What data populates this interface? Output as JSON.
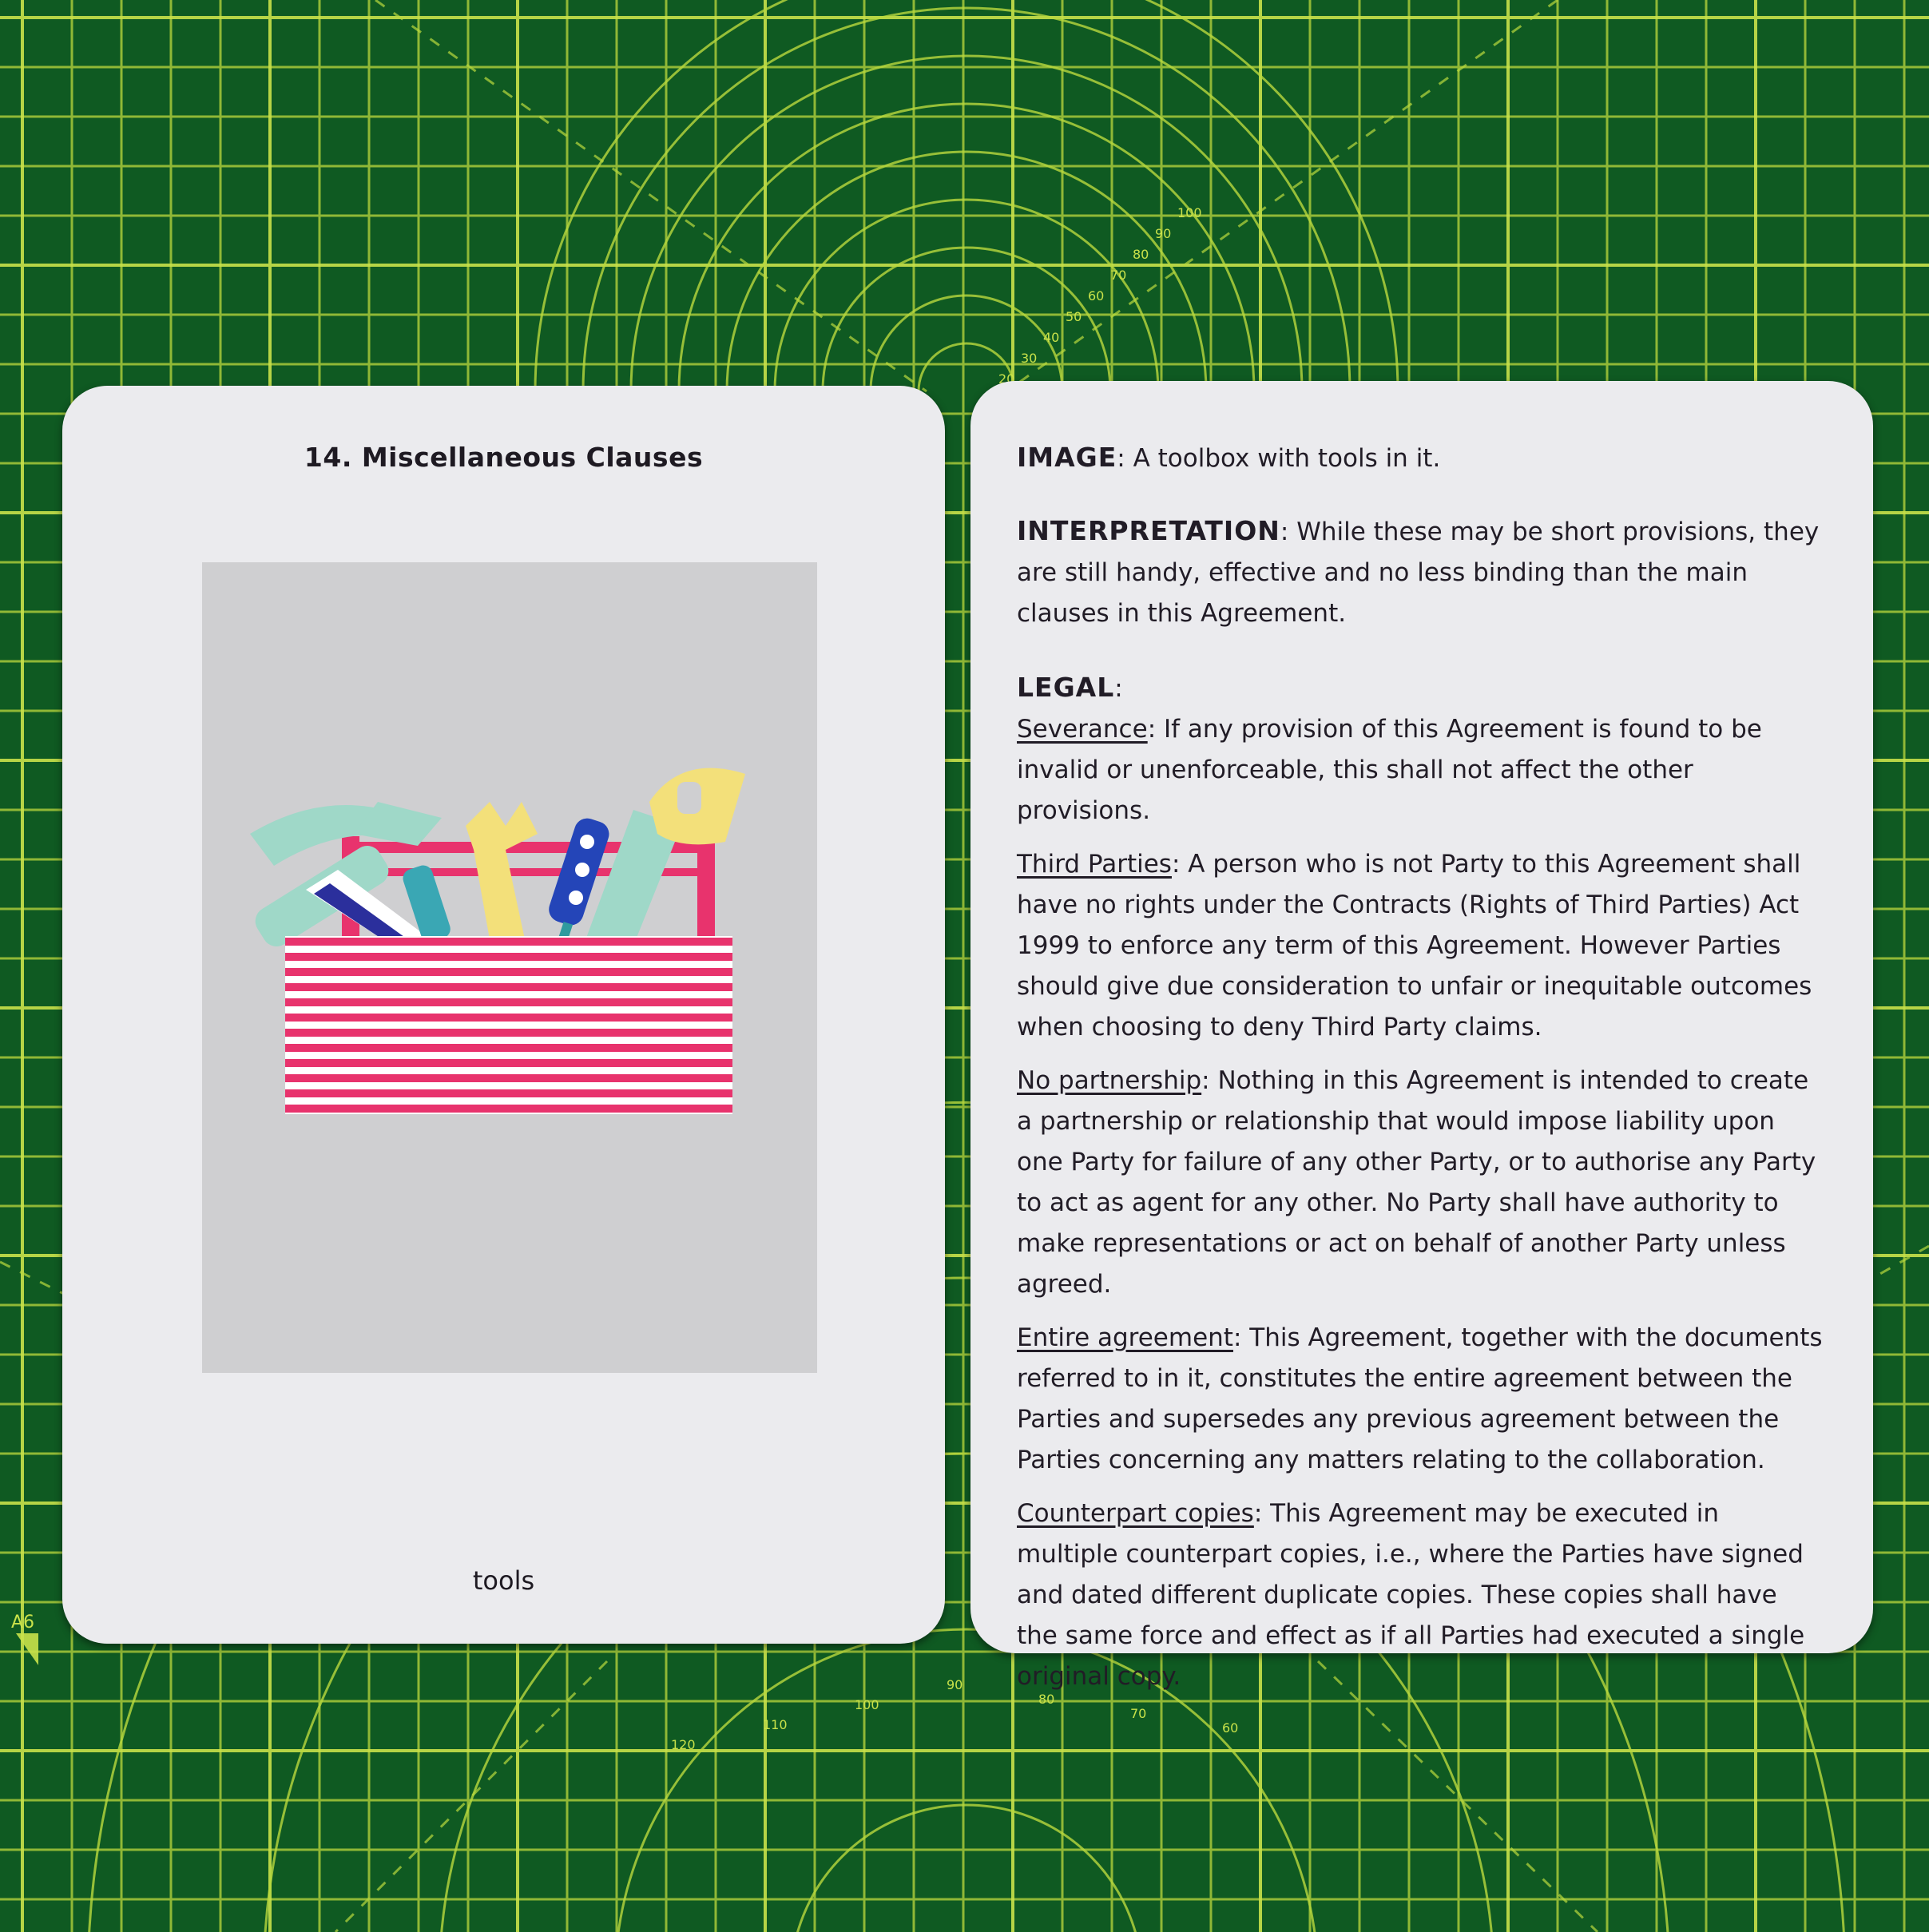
{
  "front_card": {
    "title": "14.  Miscellaneous Clauses",
    "caption": "tools"
  },
  "back_card": {
    "image_label": "IMAGE",
    "image_text": ": A toolbox with tools in it.",
    "interpretation_label": "INTERPRETATION",
    "interpretation_text": ": While these may be short provisions, they are still handy, effective and no less binding than the main clauses in this Agreement.",
    "legal_label": "LEGAL",
    "legal_colon": ":",
    "clauses": [
      {
        "title": "Severance",
        "text": ":  If any provision of this Agreement is found to be invalid or unenforceable, this shall not affect the other provisions."
      },
      {
        "title": "Third Parties",
        "text": ": A person who is not Party to this Agreement shall have no rights under the Contracts (Rights of Third Parties) Act 1999 to enforce any term of this Agreement. However Parties should give due consideration to unfair or inequitable outcomes when choosing to deny Third Party claims."
      },
      {
        "title": "No partnership",
        "text": ":  Nothing in this Agreement is intended to create a partnership or relationship that would impose liability upon one Party for failure of any other Party, or to authorise any Party to act as agent for any other. No Party shall have authority to make representations or act on behalf of another Party unless agreed."
      },
      {
        "title": "Entire agreement",
        "text": ": This Agreement, together with the documents referred to in it, constitutes the entire agreement between the Parties and supersedes any previous agreement between the Parties concerning any matters relating to the collaboration."
      },
      {
        "title": "Counterpart copies",
        "text": ": This Agreement may be executed in multiple counterpart copies, i.e., where the Parties have signed and dated different duplicate copies. These copies shall have the same force and effect as if all Parties had executed a single original copy."
      }
    ]
  },
  "mat": {
    "label": "A6",
    "top_scale": [
      "20",
      "30",
      "40",
      "50",
      "60",
      "70",
      "80",
      "90",
      "100"
    ],
    "bottom_scale": [
      "120",
      "110",
      "100",
      "90",
      "80",
      "70",
      "60"
    ]
  },
  "colors": {
    "mat_green": "#0f5a22",
    "grid_line": "#b6d63a",
    "card": "#ebebee",
    "box_pink": "#e8336d",
    "tool_mint": "#9fd8c8",
    "tool_yellow": "#f3e07a",
    "tool_blue": "#2445b8"
  }
}
